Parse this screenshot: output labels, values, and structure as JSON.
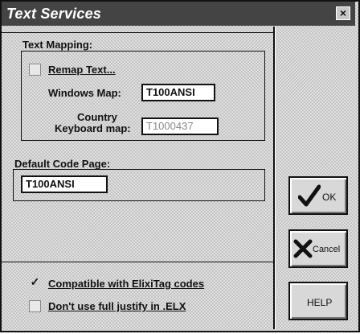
{
  "window": {
    "title": "Text Services",
    "close_glyph": "×"
  },
  "text_mapping": {
    "group_label": "Text Mapping:",
    "remap_text_label": "Remap Text...",
    "remap_text_checked": false,
    "windows_map_label": "Windows Map:",
    "windows_map_value": "T100ANSI",
    "country_label_line1": "Country",
    "country_label_line2": "Keyboard map:",
    "keyboard_map_value": "T1000437"
  },
  "code_page": {
    "group_label": "Default Code Page:",
    "value": "T100ANSI"
  },
  "options": {
    "compat_label": "Compatible with ElixiTag codes",
    "compat_checked": true,
    "compat_mark": "✓",
    "justify_label": "Don't use full justify in .ELX",
    "justify_checked": false
  },
  "buttons": {
    "ok_label": "OK",
    "cancel_label": "Cancel",
    "help_label": "HELP"
  },
  "icons": {
    "ok": "check-icon",
    "cancel": "x-icon"
  }
}
